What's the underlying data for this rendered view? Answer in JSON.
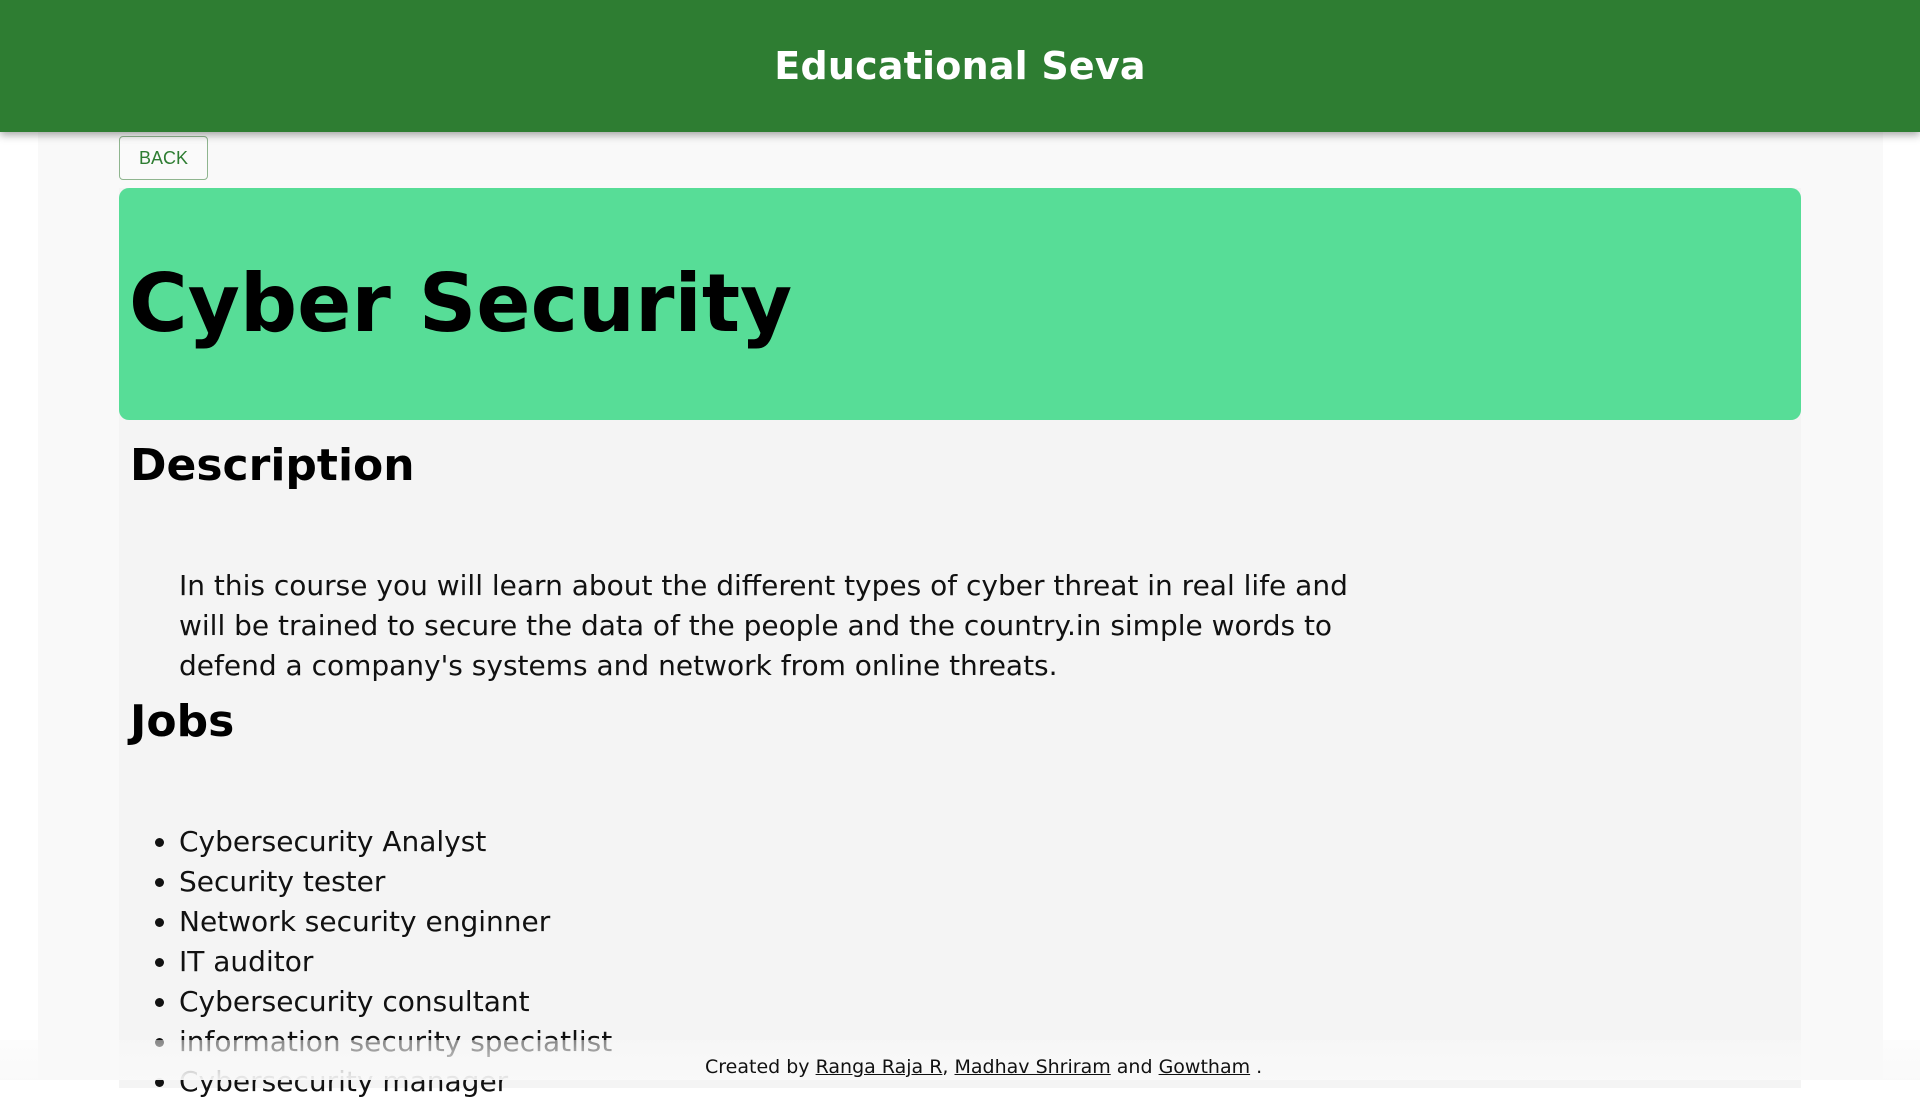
{
  "header": {
    "title": "Educational Seva"
  },
  "back_label": "BACK",
  "course": {
    "title": "Cyber Security"
  },
  "description": {
    "heading": "Description",
    "text": "In this course you will learn about the different types of cyber threat in real life and will be trained to secure the data of the people and the country.in simple words to defend a company's systems and network from online threats."
  },
  "jobs": {
    "heading": "Jobs",
    "items": [
      "Cybersecurity Analyst",
      "Security tester",
      "Network security enginner",
      "IT auditor",
      "Cybersecurity consultant",
      "information security speciatlist",
      "Cybersecurity manager"
    ]
  },
  "footer": {
    "prefix": "Created by",
    "authors": [
      "Ranga Raja R",
      "Madhav Shriram",
      "Gowtham"
    ],
    "sep": ",",
    "and": "and",
    "end": "."
  }
}
